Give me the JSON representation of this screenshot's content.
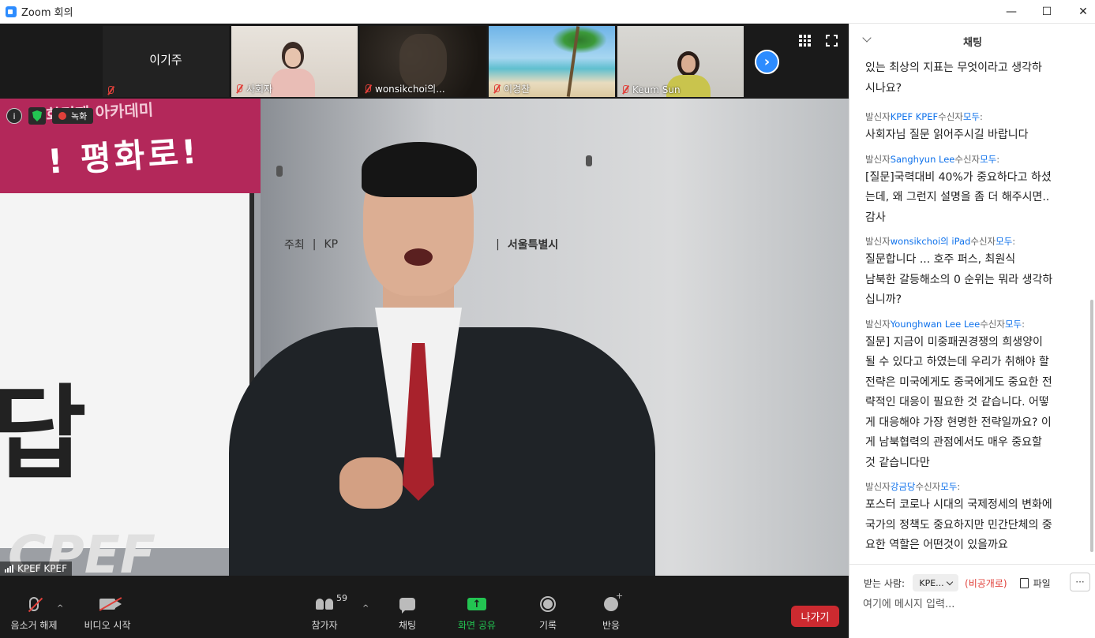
{
  "window": {
    "title": "Zoom 회의",
    "min_label": "—",
    "max_label": "☐",
    "close_label": "✕"
  },
  "strip": {
    "tiles": [
      {
        "name": "이기주",
        "muted": true
      },
      {
        "name": "사회자",
        "muted": true
      },
      {
        "name": "wonsikchoi의...",
        "muted": true
      },
      {
        "name": "이경찬",
        "muted": true
      },
      {
        "name": "Keum Sun",
        "muted": true
      }
    ],
    "next_label": "›"
  },
  "stage": {
    "speaker_name": "KPEF KPEF",
    "recording_label": "녹화",
    "info_label": "i",
    "banner_top": "평화경제 아카데미",
    "banner_text": "! 평화로!",
    "screen_glyph": "답",
    "screen_logo": "CPEF",
    "sign_left": "주최",
    "sign_mid": "KP",
    "sign_right": "서울특별시"
  },
  "toolbar": {
    "mute_label": "음소거 해제",
    "video_label": "비디오 시작",
    "participants_label": "참가자",
    "participants_count": "59",
    "chat_label": "채팅",
    "share_label": "화면 공유",
    "record_label": "기록",
    "reactions_label": "반응",
    "leave_label": "나가기",
    "caret": "^"
  },
  "chat": {
    "title": "채팅",
    "top_fragment": "있는 최상의 지표는 무엇이라고 생각하\n시나요?",
    "messages": [
      {
        "from_prefix": "발신자",
        "from": "KPEF KPEF",
        "to_prefix": "수신자",
        "to": "모두",
        "to_suffix": ":",
        "text": "사회자님 질문 읽어주시길 바랍니다"
      },
      {
        "from_prefix": "발신자",
        "from": "Sanghyun Lee",
        "to_prefix": "수신자",
        "to": "모두",
        "to_suffix": ":",
        "text": "[질문]국력대비 40%가 중요하다고 하셨\n는데, 왜 그런지 설명을 좀 더 해주시면..\n감사"
      },
      {
        "from_prefix": "발신자",
        "from": "wonsikchoi의 iPad",
        "to_prefix": "수신자",
        "to": "모두",
        "to_suffix": ":",
        "text": "질문합니다 ... 호주 퍼스, 최원식\n남북한 갈등해소의 0 순위는 뭐라 생각하\n십니까?"
      },
      {
        "from_prefix": "발신자",
        "from": "Younghwan Lee Lee",
        "to_prefix": "수신자",
        "to": "모두",
        "to_suffix": ":",
        "text": "질문] 지금이 미중패권경쟁의 희생양이\n될 수 있다고 하였는데 우리가 취해야 할\n전략은 미국에게도 중국에게도 중요한 전\n략적인 대응이 필요한 것 같습니다. 어떻\n게 대응해야 가장 현명한 전략일까요? 이\n게 남북협력의 관점에서도 매우 중요할\n것 같습니다만"
      },
      {
        "from_prefix": "발신자",
        "from": "강금당",
        "to_prefix": "수신자",
        "to": "모두",
        "to_suffix": ":",
        "text": "포스터 코로나 시대의 국제정세의 변화에\n국가의 정책도 중요하지만 민간단체의 중\n요한 역할은 어떤것이 있을까요"
      }
    ],
    "to_label": "받는 사람:",
    "to_value": "KPE...",
    "private_note": "(비공개로)",
    "file_label": "파일",
    "more_label": "···",
    "input_placeholder": "여기에 메시지 입력..."
  },
  "colors": {
    "accent": "#2d8cff",
    "leave": "#cc2a30",
    "share_green": "#23c552",
    "chat_blue": "#0e71eb",
    "private_red": "#e0403a"
  }
}
